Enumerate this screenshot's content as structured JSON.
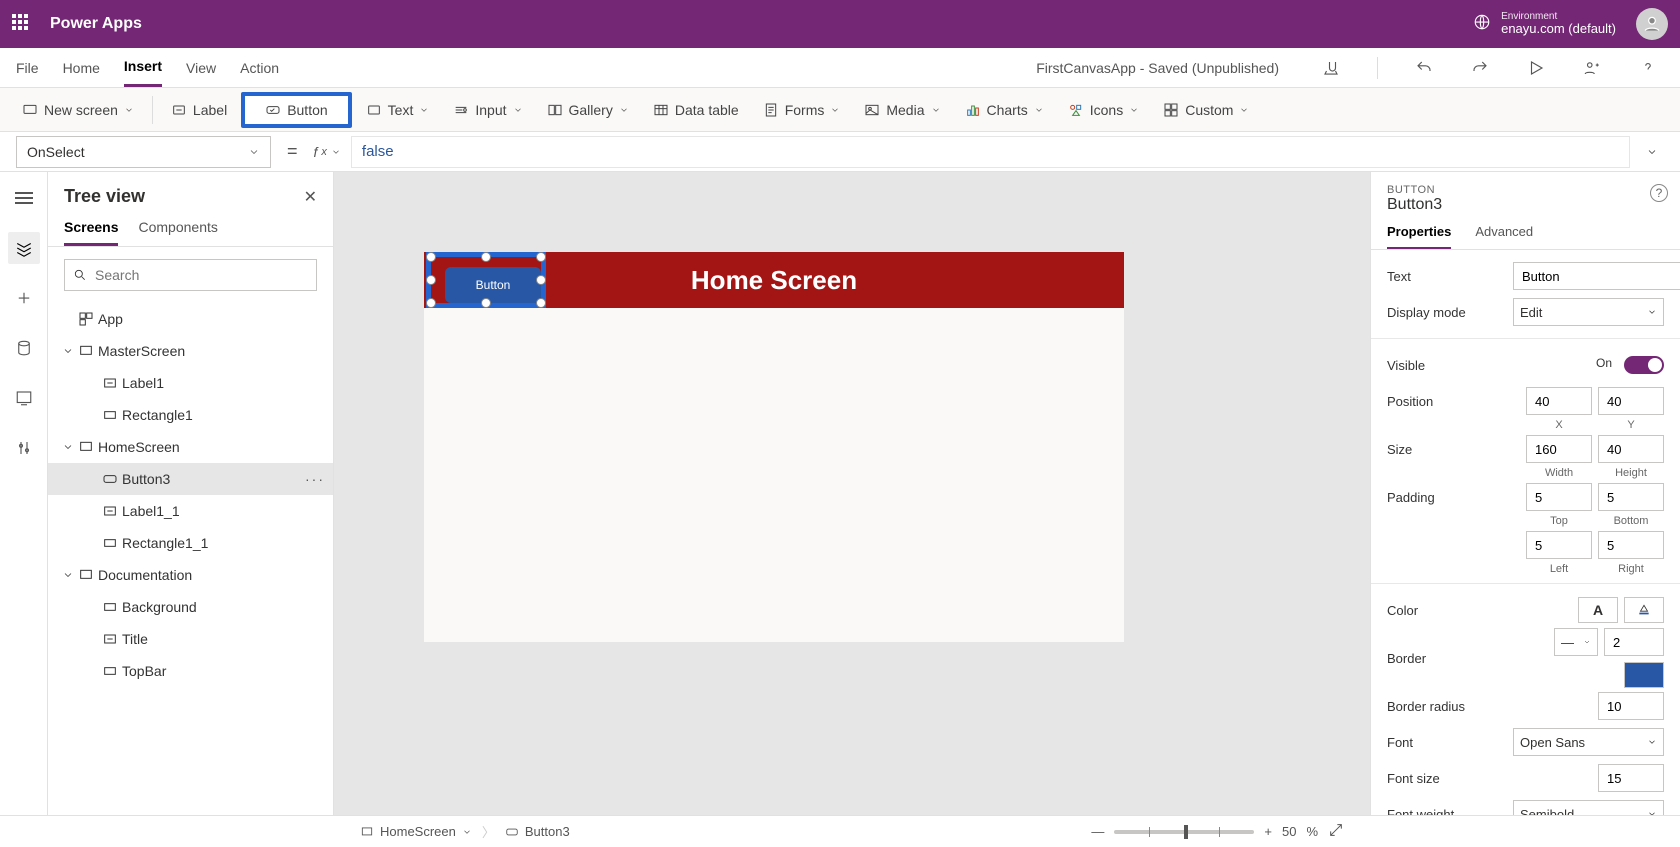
{
  "header": {
    "app_title": "Power Apps",
    "env_label": "Environment",
    "env_name": "enayu.com (default)"
  },
  "menu": {
    "file": "File",
    "home": "Home",
    "insert": "Insert",
    "view": "View",
    "action": "Action",
    "doc_title": "FirstCanvasApp - Saved (Unpublished)"
  },
  "ribbon": {
    "new_screen": "New screen",
    "label": "Label",
    "button": "Button",
    "text": "Text",
    "input": "Input",
    "gallery": "Gallery",
    "data_table": "Data table",
    "forms": "Forms",
    "media": "Media",
    "charts": "Charts",
    "icons": "Icons",
    "custom": "Custom"
  },
  "formula": {
    "property": "OnSelect",
    "value": "false"
  },
  "tree": {
    "title": "Tree view",
    "tab_screens": "Screens",
    "tab_components": "Components",
    "search_placeholder": "Search",
    "items": {
      "app": "App",
      "master": "MasterScreen",
      "label1": "Label1",
      "rect1": "Rectangle1",
      "home": "HomeScreen",
      "button3": "Button3",
      "label1_1": "Label1_1",
      "rect1_1": "Rectangle1_1",
      "doc": "Documentation",
      "bg": "Background",
      "title": "Title",
      "topbar": "TopBar"
    }
  },
  "canvas": {
    "header_text": "Home Screen",
    "button_text": "Button"
  },
  "props": {
    "type_label": "BUTTON",
    "name": "Button3",
    "tab_properties": "Properties",
    "tab_advanced": "Advanced",
    "text_label": "Text",
    "text_value": "Button",
    "display_mode_label": "Display mode",
    "display_mode_value": "Edit",
    "visible_label": "Visible",
    "visible_state": "On",
    "position_label": "Position",
    "pos_x": "40",
    "pos_y": "40",
    "x": "X",
    "y": "Y",
    "size_label": "Size",
    "size_w": "160",
    "size_h": "40",
    "width": "Width",
    "height": "Height",
    "padding_label": "Padding",
    "pad_t": "5",
    "pad_b": "5",
    "pad_l": "5",
    "pad_r": "5",
    "top": "Top",
    "bottom": "Bottom",
    "left": "Left",
    "right": "Right",
    "color_label": "Color",
    "border_label": "Border",
    "border_width": "2",
    "border_radius_label": "Border radius",
    "border_radius": "10",
    "font_label": "Font",
    "font_value": "Open Sans",
    "font_size_label": "Font size",
    "font_size": "15",
    "font_weight_label": "Font weight",
    "font_weight": "Semibold"
  },
  "status": {
    "screen": "HomeScreen",
    "selection": "Button3",
    "zoom_value": "50",
    "zoom_pct": "%",
    "plus": "+"
  }
}
